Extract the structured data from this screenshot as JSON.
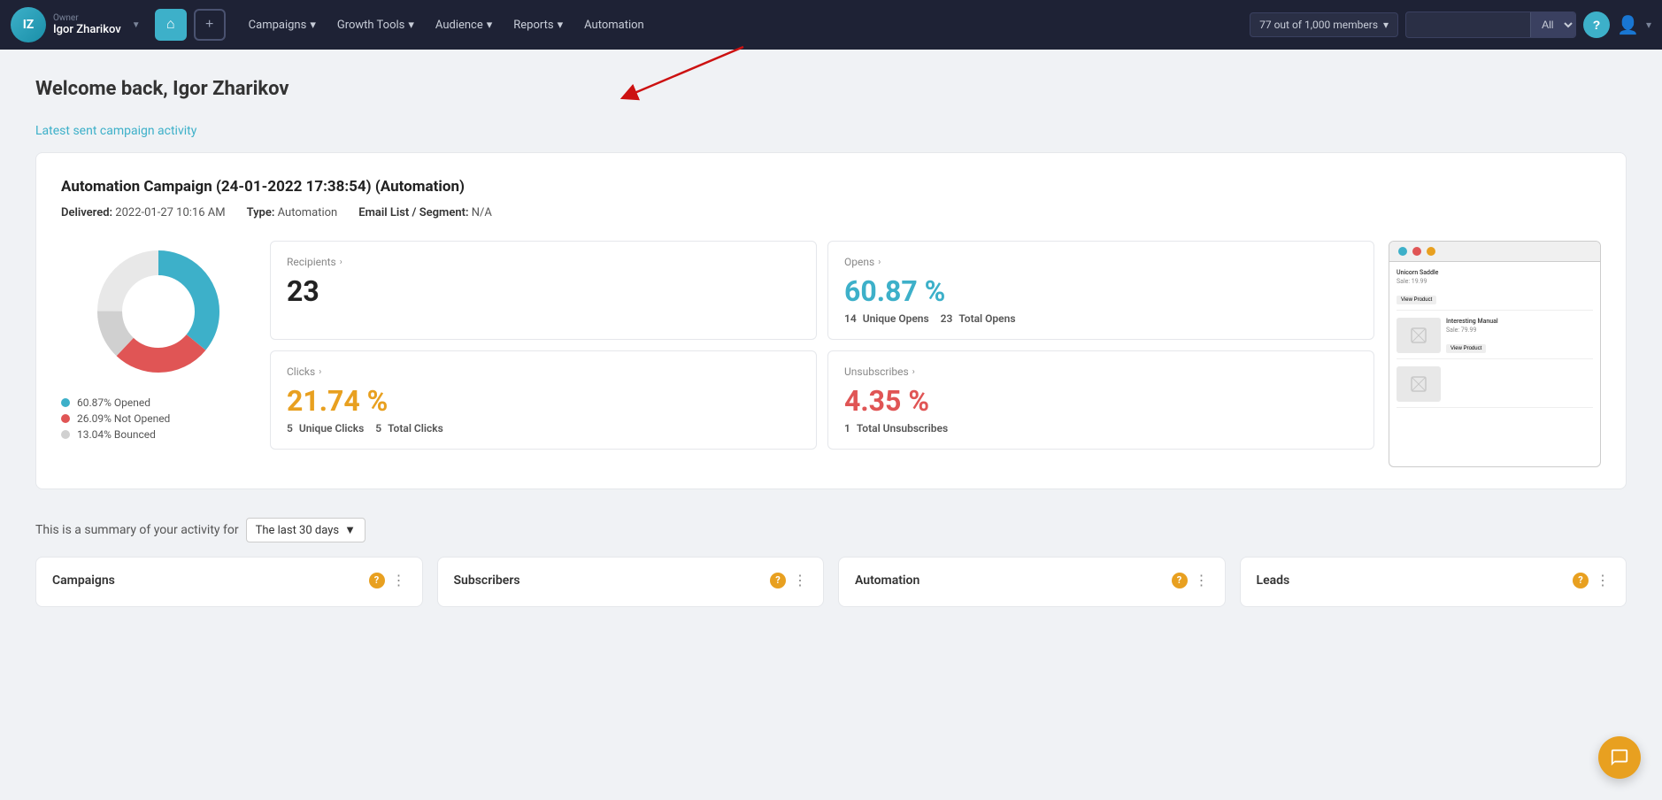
{
  "app": {
    "logo_text": "IZ"
  },
  "nav": {
    "owner_label": "Owner",
    "owner_name": "Igor Zharikov",
    "home_icon": "⌂",
    "plus_icon": "+",
    "menu_items": [
      {
        "label": "Campaigns",
        "has_chevron": true
      },
      {
        "label": "Growth Tools",
        "has_chevron": true
      },
      {
        "label": "Audience",
        "has_chevron": true
      },
      {
        "label": "Reports",
        "has_chevron": true
      },
      {
        "label": "Automation",
        "has_chevron": false
      }
    ],
    "members_badge": "77 out of 1,000 members",
    "search_placeholder": "",
    "search_filter": "All",
    "help_icon": "?",
    "user_icon": "👤",
    "chevron_icon": "▼"
  },
  "page": {
    "welcome_prefix": "Welcome back, ",
    "welcome_name": "Igor Zharikov",
    "activity_link": "Latest sent campaign activity"
  },
  "campaign": {
    "title": "Automation Campaign (24-01-2022 17:38:54) (Automation)",
    "delivered_label": "Delivered:",
    "delivered_value": "2022-01-27 10:16 AM",
    "type_label": "Type:",
    "type_value": "Automation",
    "segment_label": "Email List / Segment:",
    "segment_value": "N/A"
  },
  "donut": {
    "segments": [
      {
        "label": "60.87% Opened",
        "color": "#3db0c9",
        "value": 60.87
      },
      {
        "label": "26.09% Not Opened",
        "color": "#e05555",
        "value": 26.09
      },
      {
        "label": "13.04% Bounced",
        "color": "#d0d0d0",
        "value": 13.04
      }
    ]
  },
  "stats": {
    "recipients": {
      "title": "Recipients",
      "value": "23",
      "sub": ""
    },
    "opens": {
      "title": "Opens",
      "value": "60.87 %",
      "sub_unique_label": "14",
      "sub_unique_text": "Unique Opens",
      "sub_total_label": "23",
      "sub_total_text": "Total Opens"
    },
    "clicks": {
      "title": "Clicks",
      "value": "21.74 %",
      "sub_unique_label": "5",
      "sub_unique_text": "Unique Clicks",
      "sub_total_label": "5",
      "sub_total_text": "Total Clicks"
    },
    "unsubscribes": {
      "title": "Unsubscribes",
      "value": "4.35 %",
      "sub_total_label": "1",
      "sub_total_text": "Total Unsubscribes"
    }
  },
  "email_preview": {
    "dot1": "green",
    "dot2": "red",
    "dot3": "yellow",
    "product1_name": "Unicorn Saddle",
    "product1_price": "Sale: 19.99",
    "product1_btn": "View Product",
    "product2_name": "Interesting Manual",
    "product2_price": "Sale: 79.99",
    "product2_btn": "View Product"
  },
  "activity_summary": {
    "text": "This is a summary of your activity for",
    "period_label": "The last 30 days",
    "chevron": "▼"
  },
  "bottom_cards": [
    {
      "title": "Campaigns"
    },
    {
      "title": "Subscribers"
    },
    {
      "title": "Automation"
    },
    {
      "title": "Leads"
    }
  ],
  "chat_btn": {
    "icon": "💬"
  }
}
